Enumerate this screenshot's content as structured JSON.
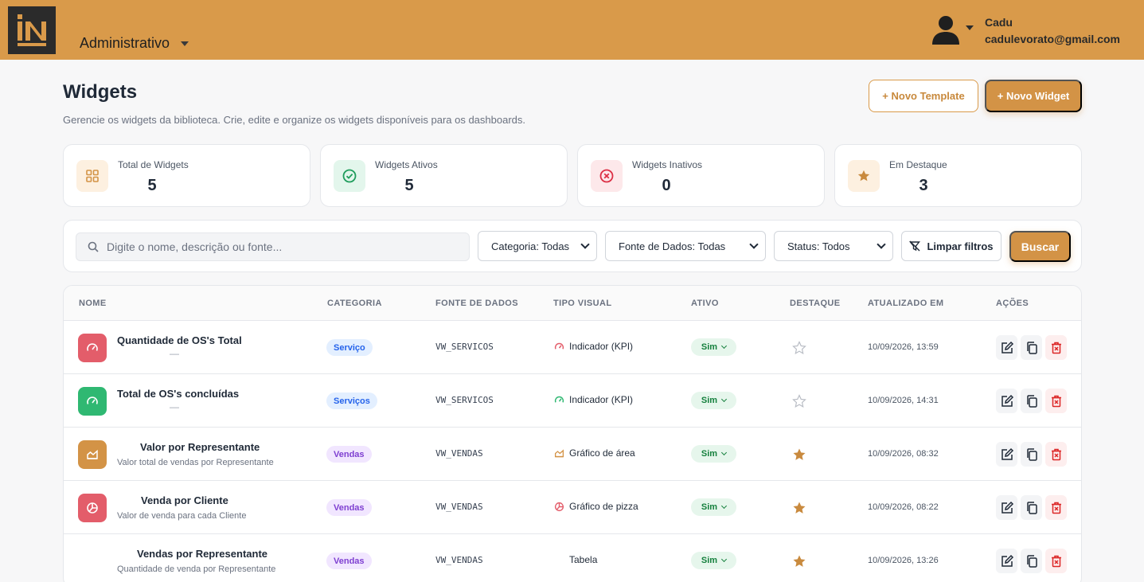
{
  "header": {
    "logo_icon": "in-logo-icon",
    "menu_label": "Administrativo",
    "user": {
      "name": "Cadu",
      "email": "cadulevorato@gmail.com",
      "avatar_icon": "user-avatar-icon"
    }
  },
  "page": {
    "title": "Widgets",
    "subtitle": "Gerencie os widgets da biblioteca. Crie, edite e organize os widgets disponíveis para os dashboards.",
    "new_template_label": "+ Novo Template",
    "new_widget_label": "+ Novo Widget"
  },
  "stats": [
    {
      "label": "Total de Widgets",
      "value": "5",
      "icon": "grid-icon"
    },
    {
      "label": "Widgets Ativos",
      "value": "5",
      "icon": "check-circle-icon"
    },
    {
      "label": "Widgets Inativos",
      "value": "0",
      "icon": "x-circle-icon"
    },
    {
      "label": "Em Destaque",
      "value": "3",
      "icon": "star-icon"
    }
  ],
  "filters": {
    "search_placeholder": "Digite o nome, descrição ou fonte...",
    "category": "Categoria: Todas",
    "source": "Fonte de Dados: Todas",
    "status": "Status: Todos",
    "clear_label": "Limpar filtros",
    "search_label": "Buscar"
  },
  "table": {
    "headers": [
      "NOME",
      "CATEGORIA",
      "FONTE DE DADOS",
      "TIPO VISUAL",
      "ATIVO",
      "DESTAQUE",
      "ATUALIZADO EM",
      "AÇÕES"
    ],
    "rows": [
      {
        "name": "Quantidade de OS's Total",
        "desc": "—",
        "category": "Serviço",
        "source": "VW_SERVICOS",
        "visual": "Indicador (KPI)",
        "active": "Sim",
        "featured": false,
        "updated": "10/09/2026, 13:59",
        "icon": "gauge-icon"
      },
      {
        "name": "Total de OS's concluídas",
        "desc": "—",
        "category": "Serviços",
        "source": "VW_SERVICOS",
        "visual": "Indicador (KPI)",
        "active": "Sim",
        "featured": false,
        "updated": "10/09/2026, 14:31",
        "icon": "gauge-icon"
      },
      {
        "name": "Valor por Representante",
        "desc": "Valor total de vendas por Representante",
        "category": "Vendas",
        "source": "VW_VENDAS",
        "visual": "Gráfico de área",
        "active": "Sim",
        "featured": true,
        "updated": "10/09/2026, 08:32",
        "icon": "area-chart-icon"
      },
      {
        "name": "Venda por Cliente",
        "desc": "Valor de venda para cada Cliente",
        "category": "Vendas",
        "source": "VW_VENDAS",
        "visual": "Gráfico de pizza",
        "active": "Sim",
        "featured": true,
        "updated": "10/09/2026, 08:22",
        "icon": "pie-chart-icon"
      },
      {
        "name": "Vendas por Representante",
        "desc": "Quantidade de venda por Representante",
        "category": "Vendas",
        "source": "VW_VENDAS",
        "visual": "Tabela",
        "active": "Sim",
        "featured": true,
        "updated": "10/09/2026, 13:26",
        "icon": "table-icon"
      }
    ]
  },
  "colors": {
    "header_bg": "#d99a4a",
    "accent": "#d39346",
    "kpi_red": "#e35d6a",
    "kpi_green": "#2fb872",
    "star_gold": "#c98a3e",
    "badge_blue_bg": "#e3efff",
    "badge_purple_bg": "#f1e6ff"
  }
}
